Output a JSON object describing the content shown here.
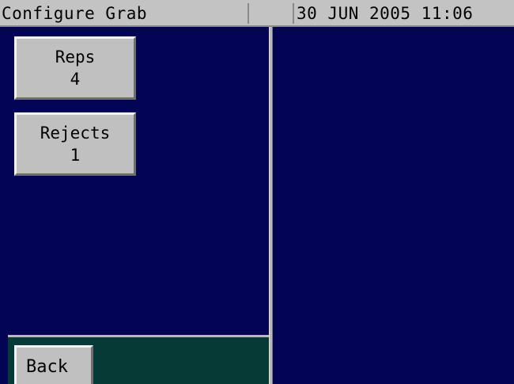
{
  "header": {
    "title": "Configure Grab",
    "datetime": "30 JUN 2005 11:06"
  },
  "buttons": {
    "reps": {
      "label": "Reps",
      "value": "4"
    },
    "rejects": {
      "label": "Rejects",
      "value": "1"
    },
    "back": {
      "label": "Back"
    }
  },
  "colors": {
    "background": "#040454",
    "bottom_bar": "#063a36",
    "title_bar": "#c3c3c3",
    "button_face": "#c0c0c0"
  }
}
